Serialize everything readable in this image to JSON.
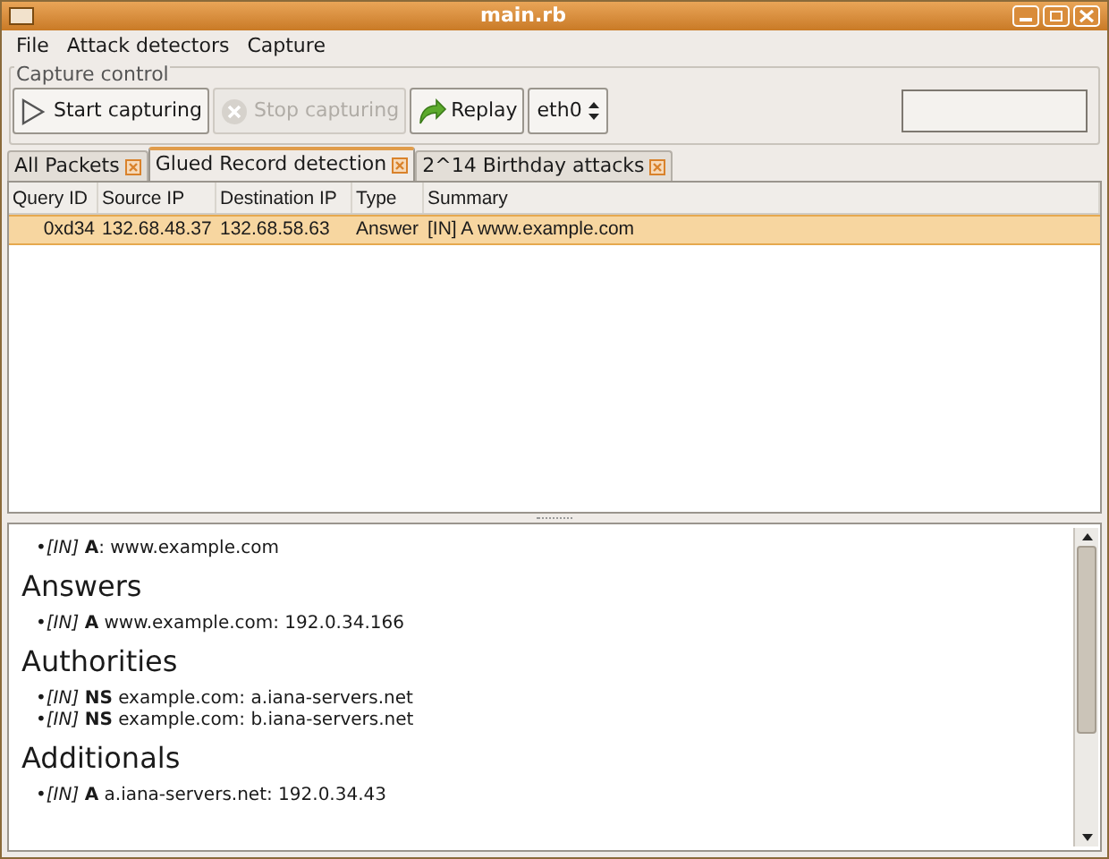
{
  "window": {
    "title": "main.rb"
  },
  "menu": [
    {
      "label": "File"
    },
    {
      "label": "Attack detectors"
    },
    {
      "label": "Capture"
    }
  ],
  "capture_control": {
    "title": "Capture control",
    "buttons": [
      {
        "label": "Start capturing",
        "kind": "play",
        "disabled": false
      },
      {
        "label": "Stop capturing",
        "kind": "stop",
        "disabled": true
      },
      {
        "label": "Replay",
        "kind": "replay",
        "disabled": false
      }
    ],
    "interface": {
      "value": "eth0"
    },
    "progress": {
      "level": 0
    }
  },
  "tabs": [
    {
      "label": "All Packets",
      "selected": false
    },
    {
      "label": "Glued Record detection",
      "selected": true
    },
    {
      "label": "2^14 Birthday attacks",
      "selected": false
    }
  ],
  "table": {
    "columns": [
      "Query ID",
      "Source IP",
      "Destination IP",
      "Type",
      "Summary"
    ],
    "rows": [
      {
        "cells": [
          "0xd34",
          "132.68.48.37",
          "132.68.58.63",
          "Answer",
          "[IN] A www.example.com"
        ],
        "selected": true
      }
    ]
  },
  "details": [
    {
      "items": [
        "•*[IN]* **A**: www.example.com"
      ]
    },
    {
      "heading": "Answers",
      "items": [
        "•*[IN]* **A** www.example.com: 192.0.34.166"
      ]
    },
    {
      "heading": "Authorities",
      "items": [
        "•*[IN]* **NS** example.com: a.iana-servers.net",
        "•*[IN]* **NS** example.com: b.iana-servers.net"
      ]
    },
    {
      "heading": "Additionals",
      "items": [
        "•*[IN]* **A** a.iana-servers.net: 192.0.34.43"
      ]
    }
  ]
}
